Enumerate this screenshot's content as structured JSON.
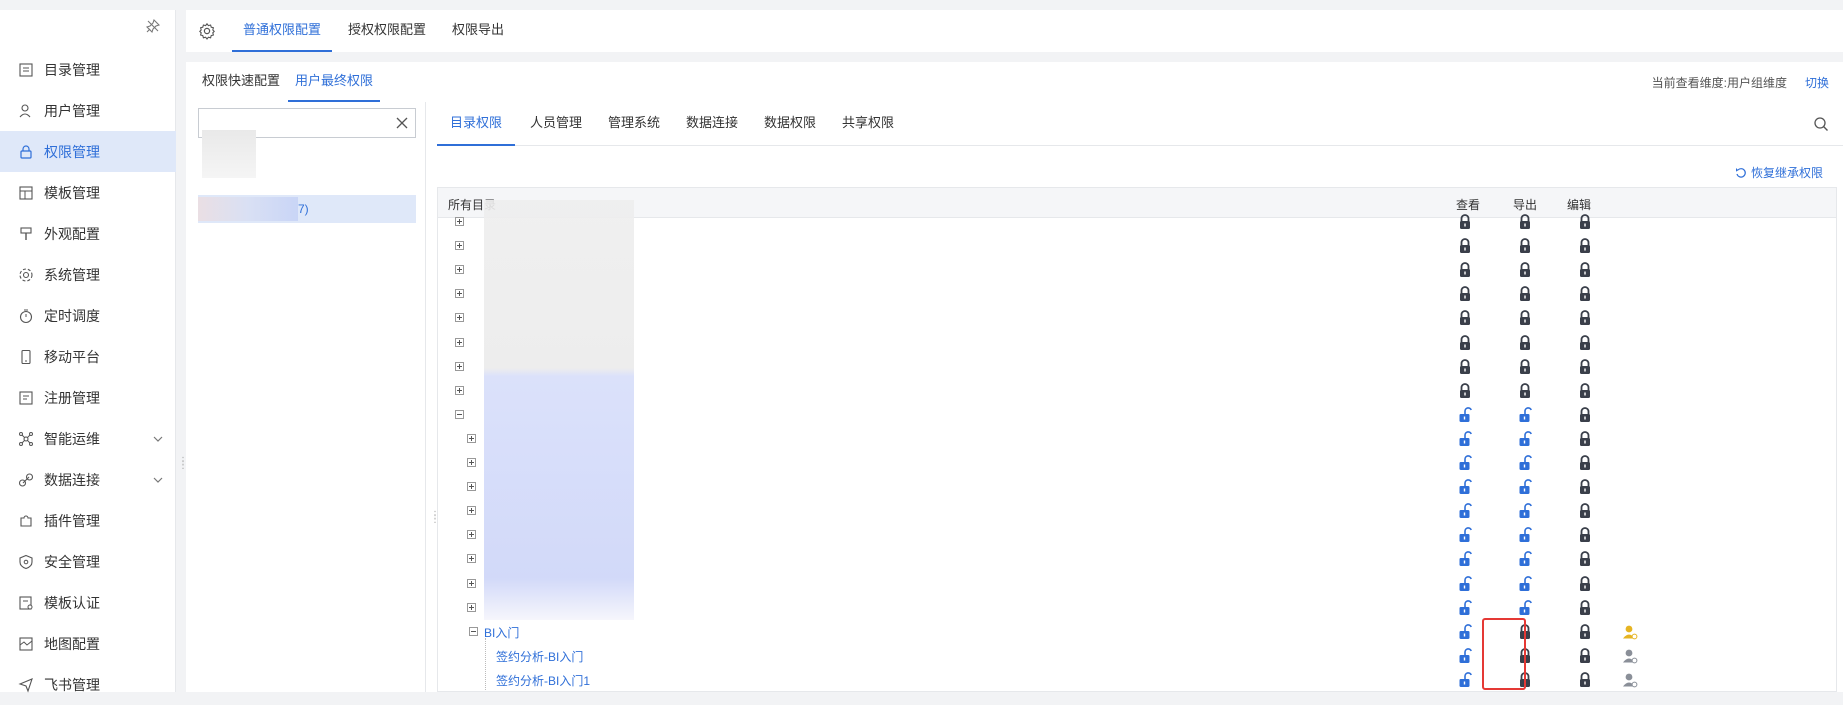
{
  "sidebar": {
    "items": [
      {
        "label": "目录管理",
        "icon": "list-icon"
      },
      {
        "label": "用户管理",
        "icon": "user-icon"
      },
      {
        "label": "权限管理",
        "icon": "lock-icon",
        "active": true
      },
      {
        "label": "模板管理",
        "icon": "template-icon"
      },
      {
        "label": "外观配置",
        "icon": "brush-icon"
      },
      {
        "label": "系统管理",
        "icon": "gear-icon"
      },
      {
        "label": "定时调度",
        "icon": "timer-icon"
      },
      {
        "label": "移动平台",
        "icon": "mobile-icon"
      },
      {
        "label": "注册管理",
        "icon": "register-icon"
      },
      {
        "label": "智能运维",
        "icon": "network-icon",
        "expandable": true
      },
      {
        "label": "数据连接",
        "icon": "link-icon",
        "expandable": true
      },
      {
        "label": "插件管理",
        "icon": "puzzle-icon"
      },
      {
        "label": "安全管理",
        "icon": "shield-icon"
      },
      {
        "label": "模板认证",
        "icon": "certificate-icon"
      },
      {
        "label": "地图配置",
        "icon": "map-icon"
      },
      {
        "label": "飞书管理",
        "icon": "send-icon"
      }
    ]
  },
  "top_tabs": [
    "普通权限配置",
    "授权权限配置",
    "权限导出"
  ],
  "sub_tabs": [
    "权限快速配置",
    "用户最终权限"
  ],
  "dimension_text": "当前查看维度:用户组维度",
  "switch_label": "切换",
  "user_list": {
    "search_value": "",
    "selected_item_suffix": "7)"
  },
  "perm_tabs": [
    "目录权限",
    "人员管理",
    "管理系统",
    "数据连接",
    "数据权限",
    "共享权限"
  ],
  "restore_label": "恢复继承权限",
  "table": {
    "col_name": "所有目录",
    "col_view": "查看",
    "col_export": "导出",
    "col_edit": "编辑",
    "named_nodes": [
      "BI入门",
      "签约分析-BI入门",
      "签约分析-BI入门1"
    ]
  },
  "colors": {
    "accent": "#2f6fd8",
    "lock_dark": "#3a3f4a",
    "highlight": "#e53935",
    "user_gold": "#e6b422"
  }
}
